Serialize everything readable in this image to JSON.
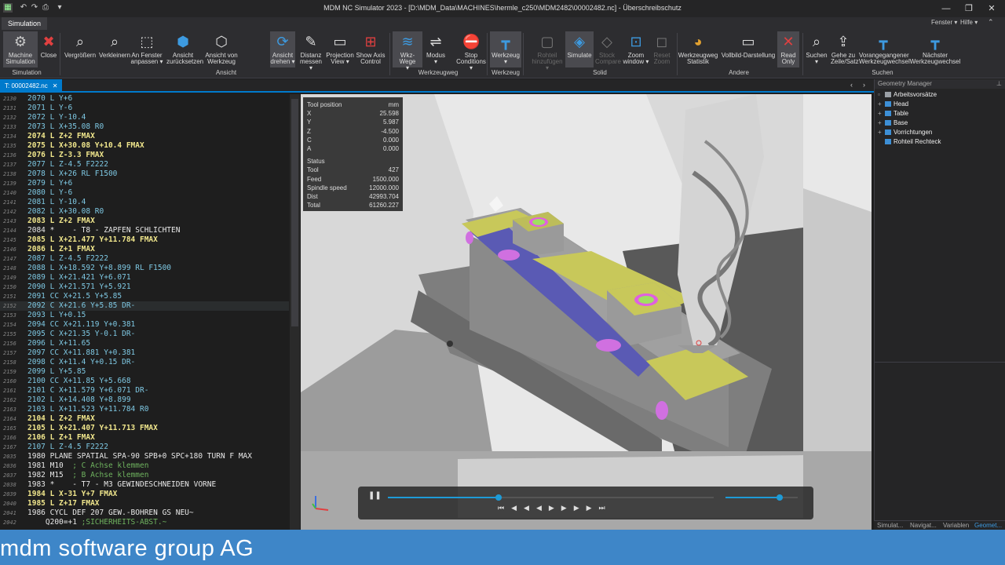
{
  "window": {
    "title": "MDM NC Simulator 2023 - [D:\\MDM_Data\\MACHINES\\hermle_c250\\MDM2482\\00002482.nc] - Überschreibschutz",
    "menu_right": [
      "Fenster ▾",
      "Hilfe ▾"
    ]
  },
  "ribbon": {
    "tab": "Simulation",
    "buttons": [
      {
        "label1": "Machine",
        "label2": "Simulation"
      },
      {
        "label1": "Close",
        "label2": ""
      },
      {
        "label1": "Vergrößern",
        "label2": ""
      },
      {
        "label1": "Verkleinern",
        "label2": ""
      },
      {
        "label1": "An Fenster",
        "label2": "anpassen ▾"
      },
      {
        "label1": "Ansicht",
        "label2": "zurücksetzen"
      },
      {
        "label1": "Ansicht von",
        "label2": "Werkzeug"
      },
      {
        "label1": "Ansicht",
        "label2": "drehen ▾"
      },
      {
        "label1": "Distanz",
        "label2": "messen ▾"
      },
      {
        "label1": "Projection",
        "label2": "View ▾"
      },
      {
        "label1": "Show Axis",
        "label2": "Control"
      },
      {
        "label1": "Wkz-Wege",
        "label2": "▾"
      },
      {
        "label1": "Modus",
        "label2": "▾"
      },
      {
        "label1": "Stop",
        "label2": "Conditions ▾"
      },
      {
        "label1": "Werkzeug",
        "label2": "▾"
      },
      {
        "label1": "Rohteil",
        "label2": "hinzufügen ▾"
      },
      {
        "label1": "Simulate",
        "label2": ""
      },
      {
        "label1": "Stock",
        "label2": "Compare"
      },
      {
        "label1": "Zoom",
        "label2": "window ▾"
      },
      {
        "label1": "Reset",
        "label2": "Zoom"
      },
      {
        "label1": "Werkzeugweg",
        "label2": "Statistik"
      },
      {
        "label1": "Vollbild-Darstellung",
        "label2": ""
      },
      {
        "label1": "Read",
        "label2": "Only"
      },
      {
        "label1": "Suchen",
        "label2": "▾"
      },
      {
        "label1": "Gehe zu",
        "label2": "Zeile/Satz"
      },
      {
        "label1": "Vorangegangener",
        "label2": "Werkzeugwechsel"
      },
      {
        "label1": "Nächster",
        "label2": "Werkzeugwechsel"
      }
    ],
    "groups": [
      "Simulation",
      "Ansicht",
      "Werkzeugweg",
      "Werkzeug",
      "Solid",
      "Andere",
      "Suchen"
    ]
  },
  "document_tab": "00002482.nc",
  "editor": {
    "lines": [
      {
        "n": "2130",
        "t": "2070 L Y+6",
        "s": "d"
      },
      {
        "n": "2131",
        "t": "2071 L Y-6",
        "s": "d"
      },
      {
        "n": "2132",
        "t": "2072 L Y-10.4",
        "s": "d"
      },
      {
        "n": "2133",
        "t": "2073 L X+35.08 R0",
        "s": "d"
      },
      {
        "n": "2134",
        "t": "2074 L Z+2 FMAX",
        "s": "k"
      },
      {
        "n": "2135",
        "t": "2075 L X+30.08 Y+10.4 FMAX",
        "s": "k"
      },
      {
        "n": "2136",
        "t": "2076 L Z-3.3 FMAX",
        "s": "k"
      },
      {
        "n": "2137",
        "t": "2077 L Z-4.5 F2222",
        "s": "d"
      },
      {
        "n": "2138",
        "t": "2078 L X+26 RL F1500",
        "s": "d"
      },
      {
        "n": "2139",
        "t": "2079 L Y+6",
        "s": "d"
      },
      {
        "n": "2140",
        "t": "2080 L Y-6",
        "s": "d"
      },
      {
        "n": "2141",
        "t": "2081 L Y-10.4",
        "s": "d"
      },
      {
        "n": "2142",
        "t": "2082 L X+30.08 R0",
        "s": "d"
      },
      {
        "n": "2143",
        "t": "2083 L Z+2 FMAX",
        "s": "k"
      },
      {
        "n": "2144",
        "t": "2084 *    - T8 - ZAPFEN SCHLICHTEN",
        "s": "w"
      },
      {
        "n": "2145",
        "t": "2085 L X+21.477 Y+11.784 FMAX",
        "s": "k"
      },
      {
        "n": "2146",
        "t": "2086 L Z+1 FMAX",
        "s": "k"
      },
      {
        "n": "2147",
        "t": "2087 L Z-4.5 F2222",
        "s": "d"
      },
      {
        "n": "2148",
        "t": "2088 L X+18.592 Y+8.899 RL F1500",
        "s": "d"
      },
      {
        "n": "2149",
        "t": "2089 L X+21.421 Y+6.071",
        "s": "d"
      },
      {
        "n": "2150",
        "t": "2090 L X+21.571 Y+5.921",
        "s": "d"
      },
      {
        "n": "2151",
        "t": "2091 CC X+21.5 Y+5.85",
        "s": "d"
      },
      {
        "n": "2152",
        "t": "2092 C X+21.6 Y+5.85 DR-",
        "s": "d"
      },
      {
        "n": "2153",
        "t": "2093 L Y+0.15",
        "s": "d"
      },
      {
        "n": "2154",
        "t": "2094 CC X+21.119 Y+0.381",
        "s": "d"
      },
      {
        "n": "2155",
        "t": "2095 C X+21.35 Y-0.1 DR-",
        "s": "d"
      },
      {
        "n": "2156",
        "t": "2096 L X+11.65",
        "s": "d"
      },
      {
        "n": "2157",
        "t": "2097 CC X+11.881 Y+0.381",
        "s": "d"
      },
      {
        "n": "2158",
        "t": "2098 C X+11.4 Y+0.15 DR-",
        "s": "d"
      },
      {
        "n": "2159",
        "t": "2099 L Y+5.85",
        "s": "d"
      },
      {
        "n": "2160",
        "t": "2100 CC X+11.85 Y+5.668",
        "s": "d"
      },
      {
        "n": "2161",
        "t": "2101 C X+11.579 Y+6.071 DR-",
        "s": "d"
      },
      {
        "n": "2162",
        "t": "2102 L X+14.408 Y+8.899",
        "s": "d"
      },
      {
        "n": "2163",
        "t": "2103 L X+11.523 Y+11.784 R0",
        "s": "d"
      },
      {
        "n": "2164",
        "t": "2104 L Z+2 FMAX",
        "s": "k"
      },
      {
        "n": "2165",
        "t": "2105 L X+21.407 Y+11.713 FMAX",
        "s": "k"
      },
      {
        "n": "2166",
        "t": "2106 L Z+1 FMAX",
        "s": "k"
      },
      {
        "n": "2167",
        "t": "2107 L Z-4.5 F2222",
        "s": "d"
      },
      {
        "n": "2035",
        "t": "1980 PLANE SPATIAL SPA-90 SPB+0 SPC+180 TURN F MAX",
        "s": "w"
      },
      {
        "n": "2036",
        "t": "1981 M10",
        "s": "w",
        "cm": "  ; C Achse klemmen"
      },
      {
        "n": "2037",
        "t": "1982 M15",
        "s": "w",
        "cm": "  ; B Achse klemmen"
      },
      {
        "n": "2038",
        "t": "1983 *    - T7 - M3 GEWINDESCHNEIDEN VORNE",
        "s": "w"
      },
      {
        "n": "2039",
        "t": "1984 L X-31 Y+7 FMAX",
        "s": "k"
      },
      {
        "n": "2040",
        "t": "1985 L Z+17 FMAX",
        "s": "k"
      },
      {
        "n": "2041",
        "t": "1986 CYCL DEF 207 GEW.-BOHREN GS NEU~",
        "s": "w"
      },
      {
        "n": "2042",
        "t": "    Q200=+1",
        "s": "w",
        "cm": " ;SICHERHEITS-ABST.~"
      }
    ]
  },
  "tool_position": {
    "title": "Tool position",
    "unit": "mm",
    "rows": [
      {
        "k": "X",
        "v": "25.598"
      },
      {
        "k": "Y",
        "v": "5.987"
      },
      {
        "k": "Z",
        "v": "-4.500"
      },
      {
        "k": "C",
        "v": "0.000"
      },
      {
        "k": "A",
        "v": "0.000"
      }
    ],
    "status_title": "Status",
    "status": [
      {
        "k": "Tool",
        "v": "427"
      },
      {
        "k": "Feed",
        "v": "1500.000"
      },
      {
        "k": "Spindle speed",
        "v": "12000.000"
      },
      {
        "k": "Dist",
        "v": "42993.704"
      },
      {
        "k": "Total",
        "v": "61260.227"
      }
    ]
  },
  "player": {
    "progress": 0.34,
    "speed": 0.75
  },
  "geometry_manager": {
    "title": "Geometry Manager",
    "items": [
      {
        "label": "Arbeitsvorsätze",
        "pm": "▫",
        "color": "#9aa0a6"
      },
      {
        "label": "Head",
        "pm": "+",
        "color": "#3d8fd6"
      },
      {
        "label": "Table",
        "pm": "+",
        "color": "#3d8fd6"
      },
      {
        "label": "Base",
        "pm": "+",
        "color": "#3d8fd6"
      },
      {
        "label": "Vorrichtungen",
        "pm": "+",
        "color": "#3d8fd6"
      },
      {
        "label": "Rohteil Rechteck",
        "pm": "",
        "color": "#3d8fd6"
      }
    ],
    "tabs": [
      "Simulat...",
      "Navigat...",
      "Variablen",
      "Geomet..."
    ]
  },
  "footer": "mdm software group AG",
  "colors": {
    "accent": "#007acc",
    "footer": "#3e86c8",
    "code_blue": "#7ec8e3",
    "code_yellow": "#f0e68c"
  }
}
